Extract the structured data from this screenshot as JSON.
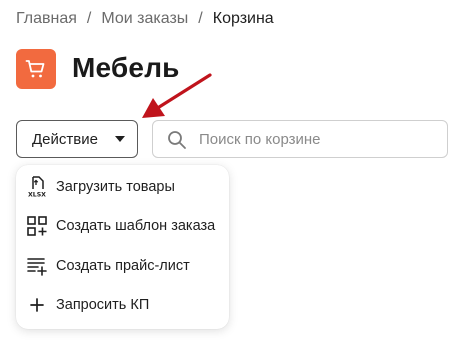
{
  "breadcrumb": {
    "items": [
      "Главная",
      "Мои заказы"
    ],
    "separator": "/",
    "current": "Корзина"
  },
  "header": {
    "title": "Мебель",
    "icon": "cart-icon",
    "icon_bg_color": "#f26a3f"
  },
  "toolbar": {
    "action_label": "Действие",
    "search_placeholder": "Поиск по корзине",
    "search_value": ""
  },
  "menu": {
    "items": [
      {
        "label": "Загрузить товары",
        "icon": "xlsx-upload-icon"
      },
      {
        "label": "Создать шаблон заказа",
        "icon": "grid-add-icon"
      },
      {
        "label": "Создать прайс-лист",
        "icon": "list-add-icon"
      },
      {
        "label": "Запросить КП",
        "icon": "plus-icon"
      }
    ]
  },
  "annotation": {
    "arrow_color": "#c0141c"
  }
}
